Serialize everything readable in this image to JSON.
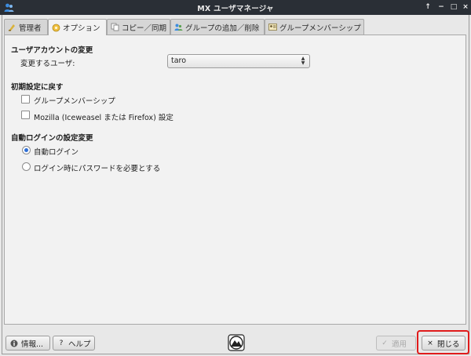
{
  "window": {
    "title": "MX ユーザマネージャ",
    "controls": [
      "↑",
      "−",
      "□",
      "×"
    ]
  },
  "tabs": [
    {
      "label": "管理者",
      "icon": "admin-icon",
      "active": false
    },
    {
      "label": "オプション",
      "icon": "options-icon",
      "active": true
    },
    {
      "label": "コピー／同期",
      "icon": "copy-sync-icon",
      "active": false
    },
    {
      "label": "グループの追加／削除",
      "icon": "group-add-remove-icon",
      "active": false
    },
    {
      "label": "グループメンバーシップ",
      "icon": "group-membership-icon",
      "active": false
    }
  ],
  "account_section": {
    "title": "ユーザアカウントの変更",
    "user_label": "変更するユーザ:",
    "user_value": "taro"
  },
  "reset_section": {
    "title": "初期設定に戻す",
    "options": [
      {
        "label": "グループメンバーシップ",
        "checked": false
      },
      {
        "label": "Mozilla (Iceweasel または Firefox) 設定",
        "checked": false
      }
    ]
  },
  "autologin_section": {
    "title": "自動ログインの設定変更",
    "options": [
      {
        "label": "自動ログイン",
        "selected": true
      },
      {
        "label": "ログイン時にパスワードを必要とする",
        "selected": false
      }
    ]
  },
  "footer": {
    "about_label": "情報...",
    "help_label": "ヘルプ",
    "apply_label": "適用",
    "close_label": "閉じる"
  },
  "colors": {
    "titlebar": "#2a2f36",
    "accent": "#2f6fd6",
    "highlight": "#e01b1b"
  }
}
